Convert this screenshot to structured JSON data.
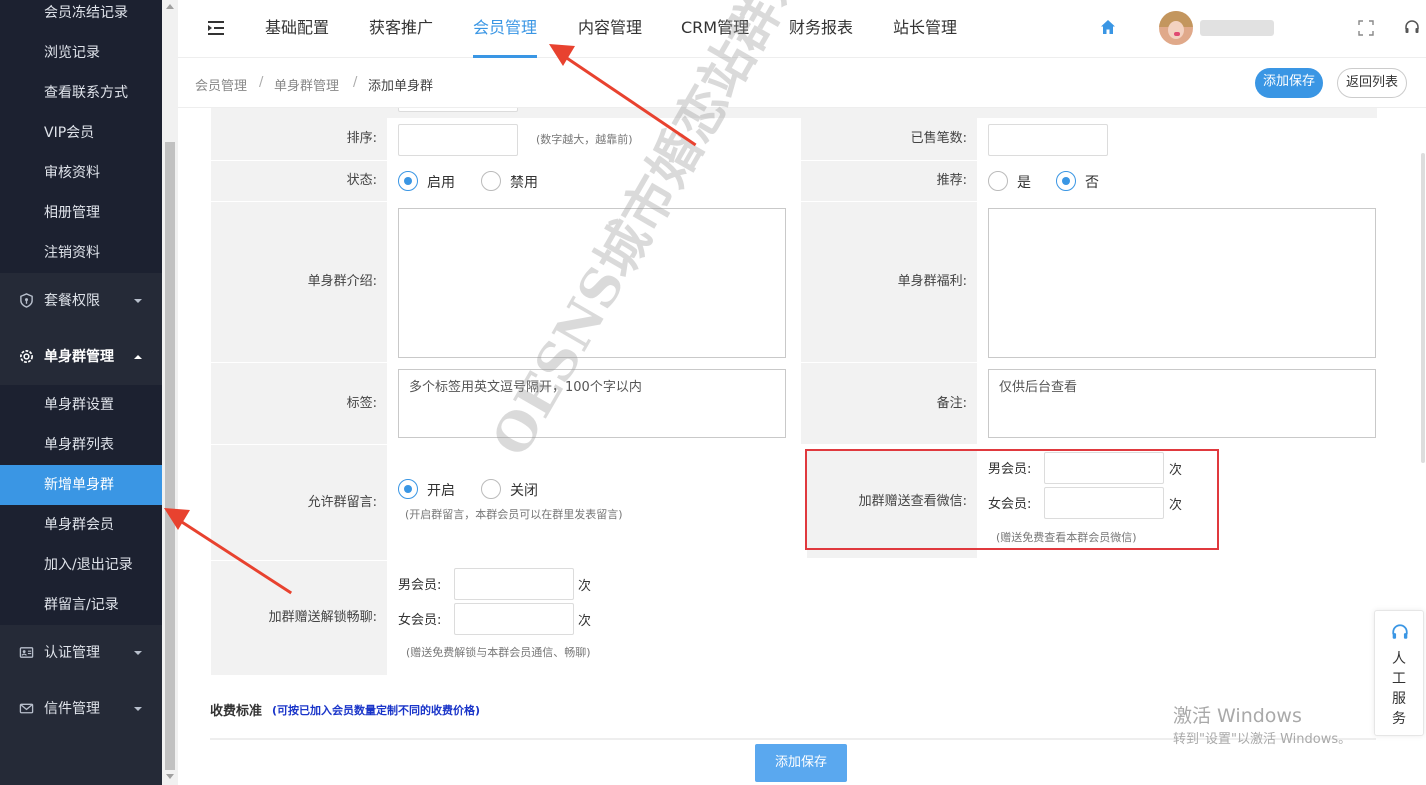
{
  "sidebar": {
    "top_items": [
      "会员冻结记录",
      "浏览记录",
      "查看联系方式",
      "VIP会员",
      "审核资料",
      "相册管理",
      "注销资料"
    ],
    "group_package": "套餐权限",
    "group_single": "单身群管理",
    "single_items": [
      "单身群设置",
      "单身群列表",
      "新增单身群",
      "单身群会员",
      "加入/退出记录",
      "群留言/记录"
    ],
    "group_auth": "认证管理",
    "group_mail": "信件管理"
  },
  "topnav": {
    "items": [
      "基础配置",
      "获客推广",
      "会员管理",
      "内容管理",
      "CRM管理",
      "财务报表",
      "站长管理"
    ],
    "active": "会员管理"
  },
  "breadcrumb": [
    "会员管理",
    "单身群管理",
    "添加单身群"
  ],
  "breadcrumb_sep": "/",
  "buttons": {
    "add_save": "添加保存",
    "back_list": "返回列表"
  },
  "form": {
    "sort_label": "排序:",
    "sort_hint": "(数字越大，越靠前)",
    "sold_label": "已售笔数:",
    "status_label": "状态:",
    "status_on": "启用",
    "status_off": "禁用",
    "recommend_label": "推荐:",
    "recommend_yes": "是",
    "recommend_no": "否",
    "intro_label": "单身群介绍:",
    "welfare_label": "单身群福利:",
    "tags_label": "标签:",
    "tags_placeholder": "多个标签用英文逗号隔开，100个字以内",
    "remark_label": "备注:",
    "remark_placeholder": "仅供后台查看",
    "allow_msg_label": "允许群留言:",
    "allow_on": "开启",
    "allow_off": "关闭",
    "allow_hint": "(开启群留言，本群会员可以在群里发表留言)",
    "wechat_label": "加群赠送查看微信:",
    "male_label": "男会员:",
    "female_label": "女会员:",
    "times": "次",
    "wechat_hint": "(赠送免费查看本群会员微信)",
    "unlock_label": "加群赠送解锁畅聊:",
    "unlock_hint": "(赠送免费解锁与本群会员通信、畅聊)",
    "fee_title": "收费标准",
    "fee_hint": "(可按已加入会员数量定制不同的收费价格)"
  },
  "service": [
    "人",
    "工",
    "服",
    "务"
  ],
  "watermark": "OESNS城市婚恋站群系统",
  "windows": {
    "line1": "激活 Windows",
    "line2": "转到\"设置\"以激活 Windows。"
  },
  "colors": {
    "accent": "#3a96e4",
    "sidebar": "#252a37",
    "highlight_box": "#e0393e",
    "arrow": "#e8422f"
  },
  "icons": [
    "menu-icon",
    "home-icon",
    "fullscreen-icon",
    "headset-icon",
    "package-icon",
    "gear-icon",
    "id-card-icon",
    "mail-icon"
  ]
}
